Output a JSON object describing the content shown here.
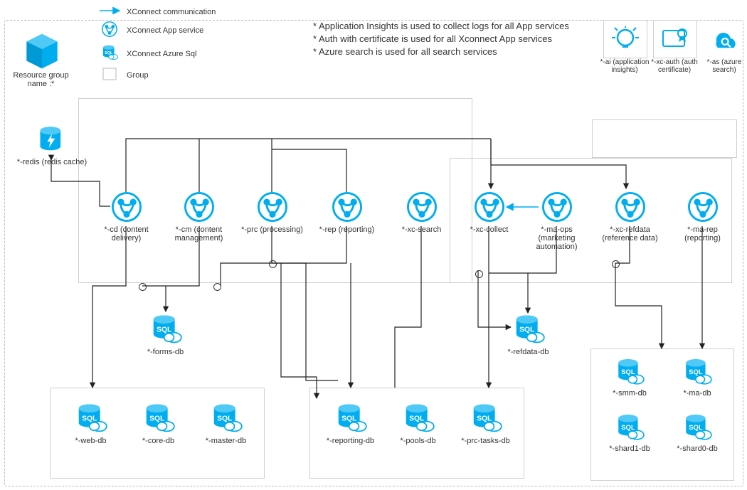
{
  "resource_group_label": "Resource group name :*",
  "legend": {
    "comm": "XConnect communication",
    "appsvc": "XConnect App service",
    "sql": "XConnect Azure Sql",
    "group": "Group"
  },
  "notes": [
    "* Application Insights is used to collect logs for all App services",
    "* Auth with certificate is used for all Xconnect App services",
    "* Azure search is used for all search services"
  ],
  "top_right": [
    {
      "name": "*-ai (application insights)"
    },
    {
      "name": "*-xc-auth (auth certificate)"
    },
    {
      "name": "*-as (azure search)"
    }
  ],
  "redis": "*-redis (redis cache)",
  "app_services": [
    {
      "label": "*-cd (content delivery)"
    },
    {
      "label": "*-cm (content management)"
    },
    {
      "label": "*-prc (processing)"
    },
    {
      "label": "*-rep (reporting)"
    },
    {
      "label": "*-xc-search"
    },
    {
      "label": "*-xc-collect"
    },
    {
      "label": "*-ma-ops (marketing automation)"
    },
    {
      "label": "*-xc-refdata (reference data)"
    },
    {
      "label": "*-ma-rep (reporting)"
    }
  ],
  "sql_single": {
    "forms": "*-forms-db",
    "refdata": "*-refdata-db"
  },
  "sql_group_left": [
    "*-web-db",
    "*-core-db",
    "*-master-db"
  ],
  "sql_group_mid": [
    "*-reporting-db",
    "*-pools-db",
    "*-prc-tasks-db"
  ],
  "sql_group_right": [
    "*-smm-db",
    "*-ma-db",
    "*-shard1-db",
    "*-shard0-db"
  ],
  "colors": {
    "accent": "#00ADEF"
  }
}
